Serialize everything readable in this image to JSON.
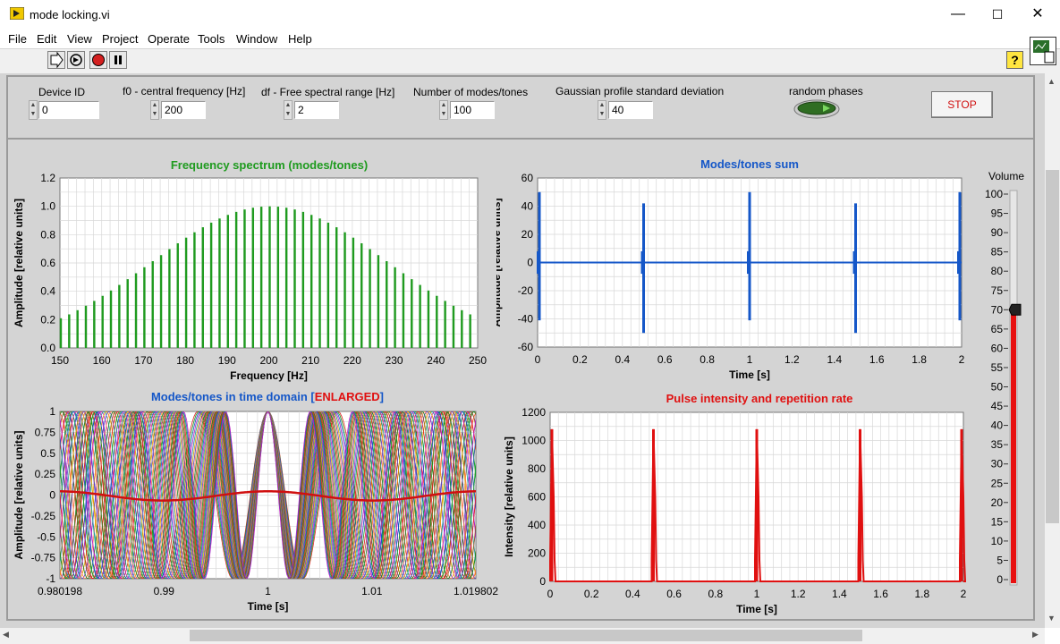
{
  "window": {
    "title": "mode locking.vi",
    "minimize": "—",
    "maximize": "☐",
    "close": "✕"
  },
  "menu": [
    "File",
    "Edit",
    "View",
    "Project",
    "Operate",
    "Tools",
    "Window",
    "Help"
  ],
  "controls": {
    "device_id": {
      "label": "Device ID",
      "value": "0"
    },
    "f0": {
      "label": "f0 - central frequency [Hz]",
      "value": "200"
    },
    "df": {
      "label": "df - Free spectral range [Hz]",
      "value": "2"
    },
    "modes": {
      "label": "Number of modes/tones",
      "value": "100"
    },
    "sigma": {
      "label": "Gaussian profile standard deviation",
      "value": "40"
    },
    "random_phases": {
      "label": "random phases",
      "state": "on"
    },
    "stop": {
      "label": "STOP"
    }
  },
  "volume": {
    "label": "Volume",
    "value": 70,
    "ticks": [
      "100",
      "95",
      "90",
      "85",
      "80",
      "75",
      "70",
      "65",
      "60",
      "55",
      "50",
      "45",
      "40",
      "35",
      "30",
      "25",
      "20",
      "15",
      "10",
      "5",
      "0"
    ]
  },
  "chart_data": [
    {
      "id": "spectrum",
      "type": "bar",
      "title": "Frequency spectrum (modes/tones)",
      "xlabel": "Frequency [Hz]",
      "ylabel": "Amplitude [relative units]",
      "xlim": [
        150,
        250
      ],
      "ylim": [
        0,
        1.2
      ],
      "xticks": [
        "150",
        "160",
        "170",
        "180",
        "190",
        "200",
        "210",
        "220",
        "230",
        "240",
        "250"
      ],
      "yticks": [
        "0.0",
        "0.2",
        "0.4",
        "0.6",
        "0.8",
        "1.0",
        "1.2"
      ],
      "center": 200,
      "sigma": 40,
      "step": 2,
      "color": "#1f9b1f"
    },
    {
      "id": "sum",
      "type": "line",
      "title": "Modes/tones sum",
      "xlabel": "Time [s]",
      "ylabel": "Amplitude [relative units]",
      "xlim": [
        0,
        2
      ],
      "ylim": [
        -60,
        60
      ],
      "xticks": [
        "0",
        "0.2",
        "0.4",
        "0.6",
        "0.8",
        "1",
        "1.2",
        "1.4",
        "1.6",
        "1.8",
        "2"
      ],
      "yticks": [
        "-60",
        "-40",
        "-20",
        "0",
        "20",
        "40",
        "60"
      ],
      "pulses": [
        0,
        0.5,
        1.0,
        1.5,
        2.0
      ],
      "peak_max": 50,
      "peak_min": -50,
      "color": "#1557c8"
    },
    {
      "id": "time",
      "type": "line",
      "title": "Modes/tones in time domain",
      "title_suffix": "ENLARGED",
      "xlabel": "Time [s]",
      "ylabel": "Amplitude [relative units]",
      "xlim": [
        0.980198,
        1.019802
      ],
      "ylim": [
        -1,
        1
      ],
      "xticks": [
        "0.980198",
        "0.99",
        "1",
        "1.01",
        "1.019802"
      ],
      "yticks": [
        "-1",
        "-0.75",
        "-0.5",
        "-0.25",
        "0",
        "0.25",
        "0.5",
        "0.75",
        "1"
      ],
      "colors": [
        "#e02020",
        "#1f9b1f",
        "#1557c8",
        "#c020c0",
        "#20a0a0",
        "#e0a000",
        "#6040c0",
        "#ff7f50",
        "#208020",
        "#a06020"
      ],
      "envelope_color": "#d01010"
    },
    {
      "id": "intensity",
      "type": "line",
      "title": "Pulse intensity and repetition rate",
      "xlabel": "Time [s]",
      "ylabel": "Intensity [relative units]",
      "xlim": [
        0,
        2
      ],
      "ylim": [
        0,
        1200
      ],
      "xticks": [
        "0",
        "0.2",
        "0.4",
        "0.6",
        "0.8",
        "1",
        "1.2",
        "1.4",
        "1.6",
        "1.8",
        "2"
      ],
      "yticks": [
        "0",
        "200",
        "400",
        "600",
        "800",
        "1000",
        "1200"
      ],
      "pulses": [
        0,
        0.5,
        1.0,
        1.5,
        2.0
      ],
      "peak": 1080,
      "color": "#e01010"
    }
  ]
}
